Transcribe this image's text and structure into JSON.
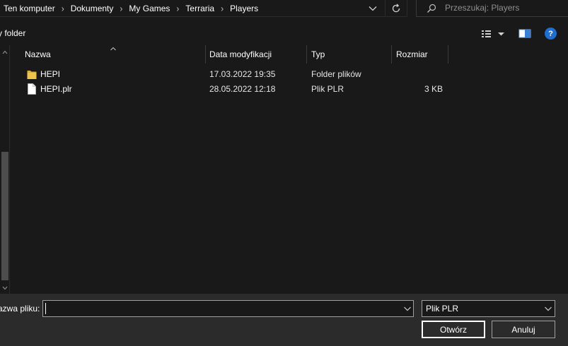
{
  "address_bar": {
    "breadcrumbs": [
      "Ten komputer",
      "Dokumenty",
      "My Games",
      "Terraria",
      "Players"
    ],
    "separator": "›",
    "dropdown_icon": "chevron-down-icon",
    "refresh_icon": "refresh-icon"
  },
  "search": {
    "placeholder": "Przeszukaj: Players",
    "icon": "search-icon"
  },
  "toolbar": {
    "new_folder_label": "y folder",
    "view_icon": "view-options-icon",
    "preview_icon": "preview-pane-icon",
    "help_label": "?"
  },
  "columns": {
    "name": "Nazwa",
    "date": "Data modyfikacji",
    "type": "Typ",
    "size": "Rozmiar"
  },
  "files": [
    {
      "name": "HEPI",
      "date": "17.03.2022 19:35",
      "type": "Folder plików",
      "size": "",
      "icon": "folder-icon"
    },
    {
      "name": "HEPI.plr",
      "date": "28.05.2022 12:18",
      "type": "Plik PLR",
      "size": "3 KB",
      "icon": "file-icon"
    }
  ],
  "footer": {
    "filename_label": "azwa pliku:",
    "filename_value": "",
    "filetype_value": "Plik PLR",
    "open_label": "Otwórz",
    "cancel_label": "Anuluj"
  },
  "colors": {
    "background": "#191919",
    "footer_background": "#2b2b2b",
    "folder_yellow": "#f0c44a",
    "help_blue": "#1e6fd0"
  }
}
